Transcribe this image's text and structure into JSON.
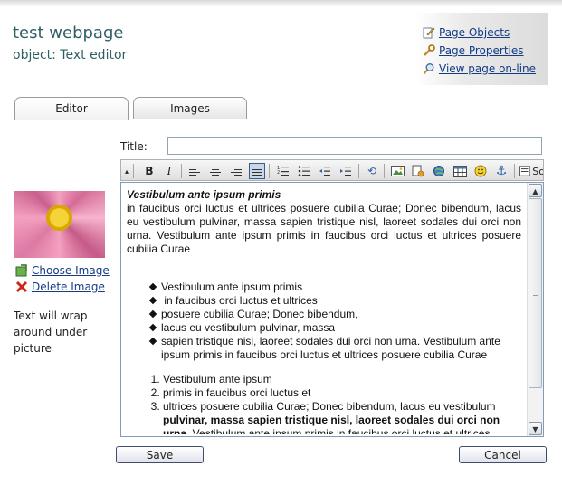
{
  "header": {
    "title": "test webpage",
    "subtitle": "object: Text editor"
  },
  "top_links": {
    "page_objects": "Page Objects",
    "page_properties": "Page Properties",
    "view_online": "View page on-line"
  },
  "tabs": {
    "editor": "Editor",
    "images": "Images"
  },
  "form": {
    "title_label": "Title:",
    "title_value": ""
  },
  "toolbar": {
    "partial_label": "So"
  },
  "editor": {
    "heading": "Vestibulum ante ipsum primis",
    "paragraph": "in faucibus orci luctus et ultrices posuere cubilia Curae; Donec bibendum, lacus eu vestibulum pulvinar, massa sapien tristique nisl, laoreet sodales dui orci non urna. Vestibulum ante ipsum primis in faucibus orci luctus et ultrices posuere cubilia Curae",
    "bullets": [
      "Vestibulum ante ipsum primis",
      " in faucibus orci luctus et ultrices",
      "posuere cubilia Curae; Donec bibendum,",
      "lacus eu vestibulum pulvinar, massa",
      "sapien tristique nisl, laoreet sodales dui orci non urna. Vestibulum ante ipsum primis in faucibus orci luctus et ultrices posuere cubilia Curae"
    ],
    "numbered": {
      "item1": "Vestibulum ante ipsum",
      "item2": "primis in faucibus orci luctus et",
      "item3_plain": "ultrices posuere cubilia Curae; Donec bibendum, lacus eu vestibulum ",
      "item3_bold": "pulvinar, massa sapien tristique nisl, laoreet sodales dui orci non urna.",
      "item3_tail": " Vestibulum ante ipsum primis in faucibus orci luctus et ultrices"
    }
  },
  "sidebar": {
    "choose_image": "Choose Image",
    "delete_image": "Delete Image",
    "wrap_note": "Text will wrap around under picture"
  },
  "buttons": {
    "save": "Save",
    "cancel": "Cancel"
  }
}
